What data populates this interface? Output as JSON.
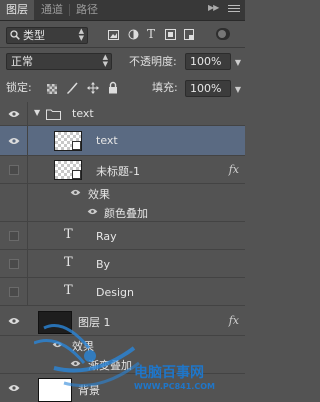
{
  "tabs": [
    {
      "label": "图层",
      "active": true
    },
    {
      "label": "通道",
      "active": false
    },
    {
      "label": "路径",
      "active": false
    }
  ],
  "filter": {
    "kind_label": "类型"
  },
  "blend": {
    "mode": "正常",
    "opacity_label": "不透明度:",
    "opacity_value": "100%"
  },
  "lock": {
    "label": "锁定:",
    "fill_label": "填充:",
    "fill_value": "100%"
  },
  "layers": {
    "group_name": "text",
    "text_layer_name": "text",
    "untitled_name": "未标题-1",
    "untitled_effects_label": "效果",
    "untitled_color_overlay": "颜色叠加",
    "type_layers": [
      "Ray",
      "By",
      "Design"
    ],
    "layer1_name": "图层 1",
    "layer1_effects_label": "效果",
    "layer1_gradient_overlay": "渐变叠加",
    "background_name": "背景",
    "fx_label": "fx"
  },
  "watermark": {
    "line1": "电脑百事网",
    "line2": "WWW.PC841.COM"
  },
  "colors": {
    "panel_bg": "#535353",
    "selected_row": "#5a6a82",
    "tab_bar": "#383838",
    "watermark_blue": "#1f76c9"
  }
}
